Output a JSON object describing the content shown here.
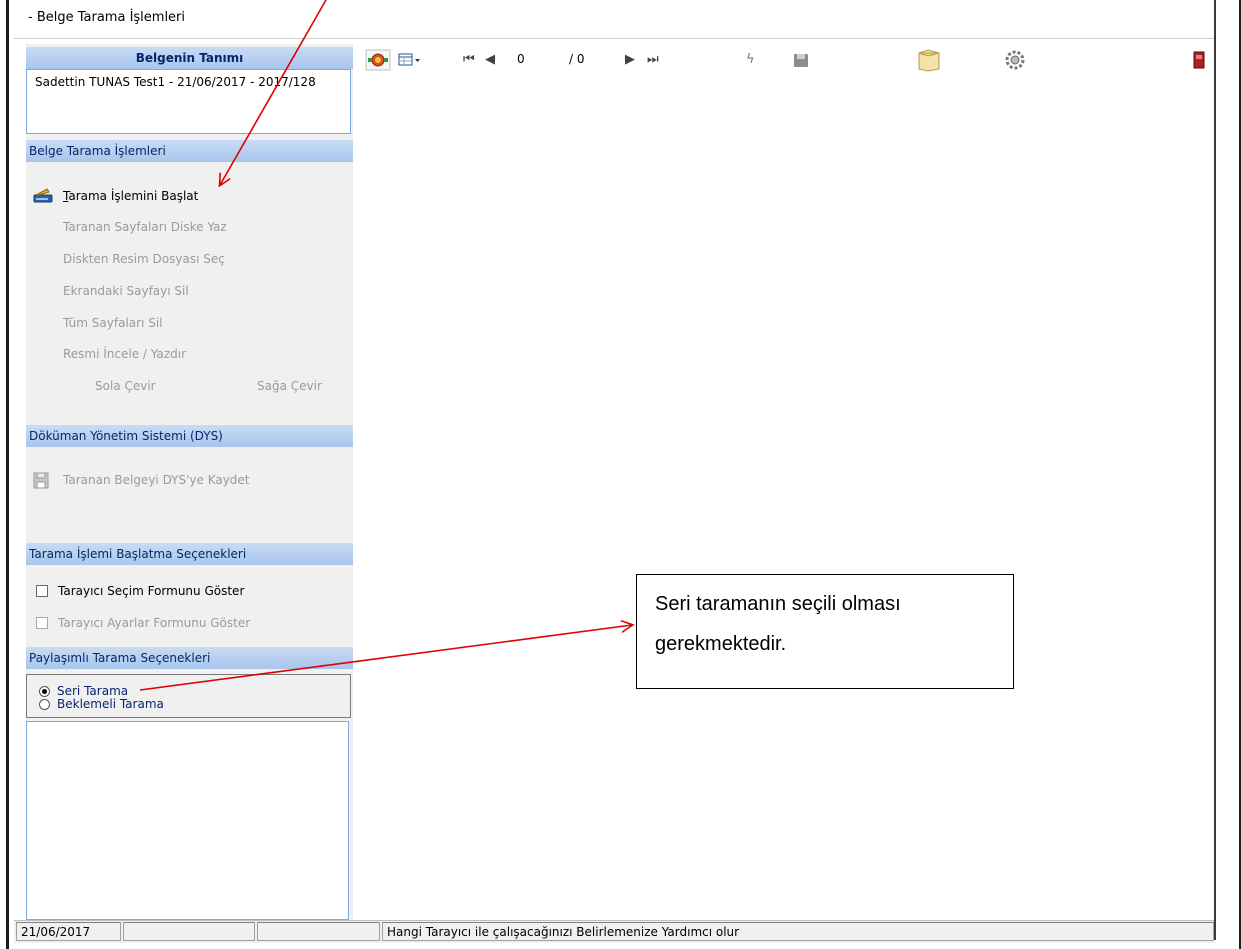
{
  "window": {
    "title": "- Belge Tarama İşlemleri"
  },
  "sidebar": {
    "doc_header": "Belgenin Tanımı",
    "doc_text": "Sadettin TUNAS Test1 - 21/06/2017 - 2017/128",
    "scan_header": "Belge Tarama İşlemleri",
    "start_first": "T",
    "start_rest": "arama İşlemini Başlat",
    "items": [
      "Taranan Sayfaları Diske Yaz",
      "Diskten Resim Dosyası Seç",
      "Ekrandaki Sayfayı Sil",
      "Tüm Sayfaları Sil",
      "Resmi İncele / Yazdır"
    ],
    "rotate_left": "Sola Çevir",
    "rotate_right": "Sağa Çevir",
    "dys_header": "Döküman Yönetim Sistemi (DYS)",
    "dys_save": "Taranan Belgeyi DYS'ye Kaydet",
    "options_header": "Tarama İşlemi Başlatma Seçenekleri",
    "opt_select_form": "Tarayıcı Seçim Formunu Göster",
    "opt_settings_form": "Tarayıcı Ayarlar Formunu Göster",
    "shared_header": "Paylaşımlı Tarama Seçenekleri",
    "radio_serial": "Seri Tarama",
    "radio_wait": "Beklemeli Tarama"
  },
  "toolbar": {
    "page_current": "0",
    "page_total": "/ 0"
  },
  "callout": {
    "line1": "Seri taramanın seçili olması",
    "line2": "gerekmektedir."
  },
  "status": {
    "date": "21/06/2017",
    "hint": "Hangi Tarayıcı ile çalışacağınızı Belirlemenize Yardımcı olur"
  },
  "colors": {
    "header_bg": "#b4cff0",
    "header_text": "#0a246a",
    "disabled_text": "#9a9a9a",
    "arrow": "#e00000"
  }
}
